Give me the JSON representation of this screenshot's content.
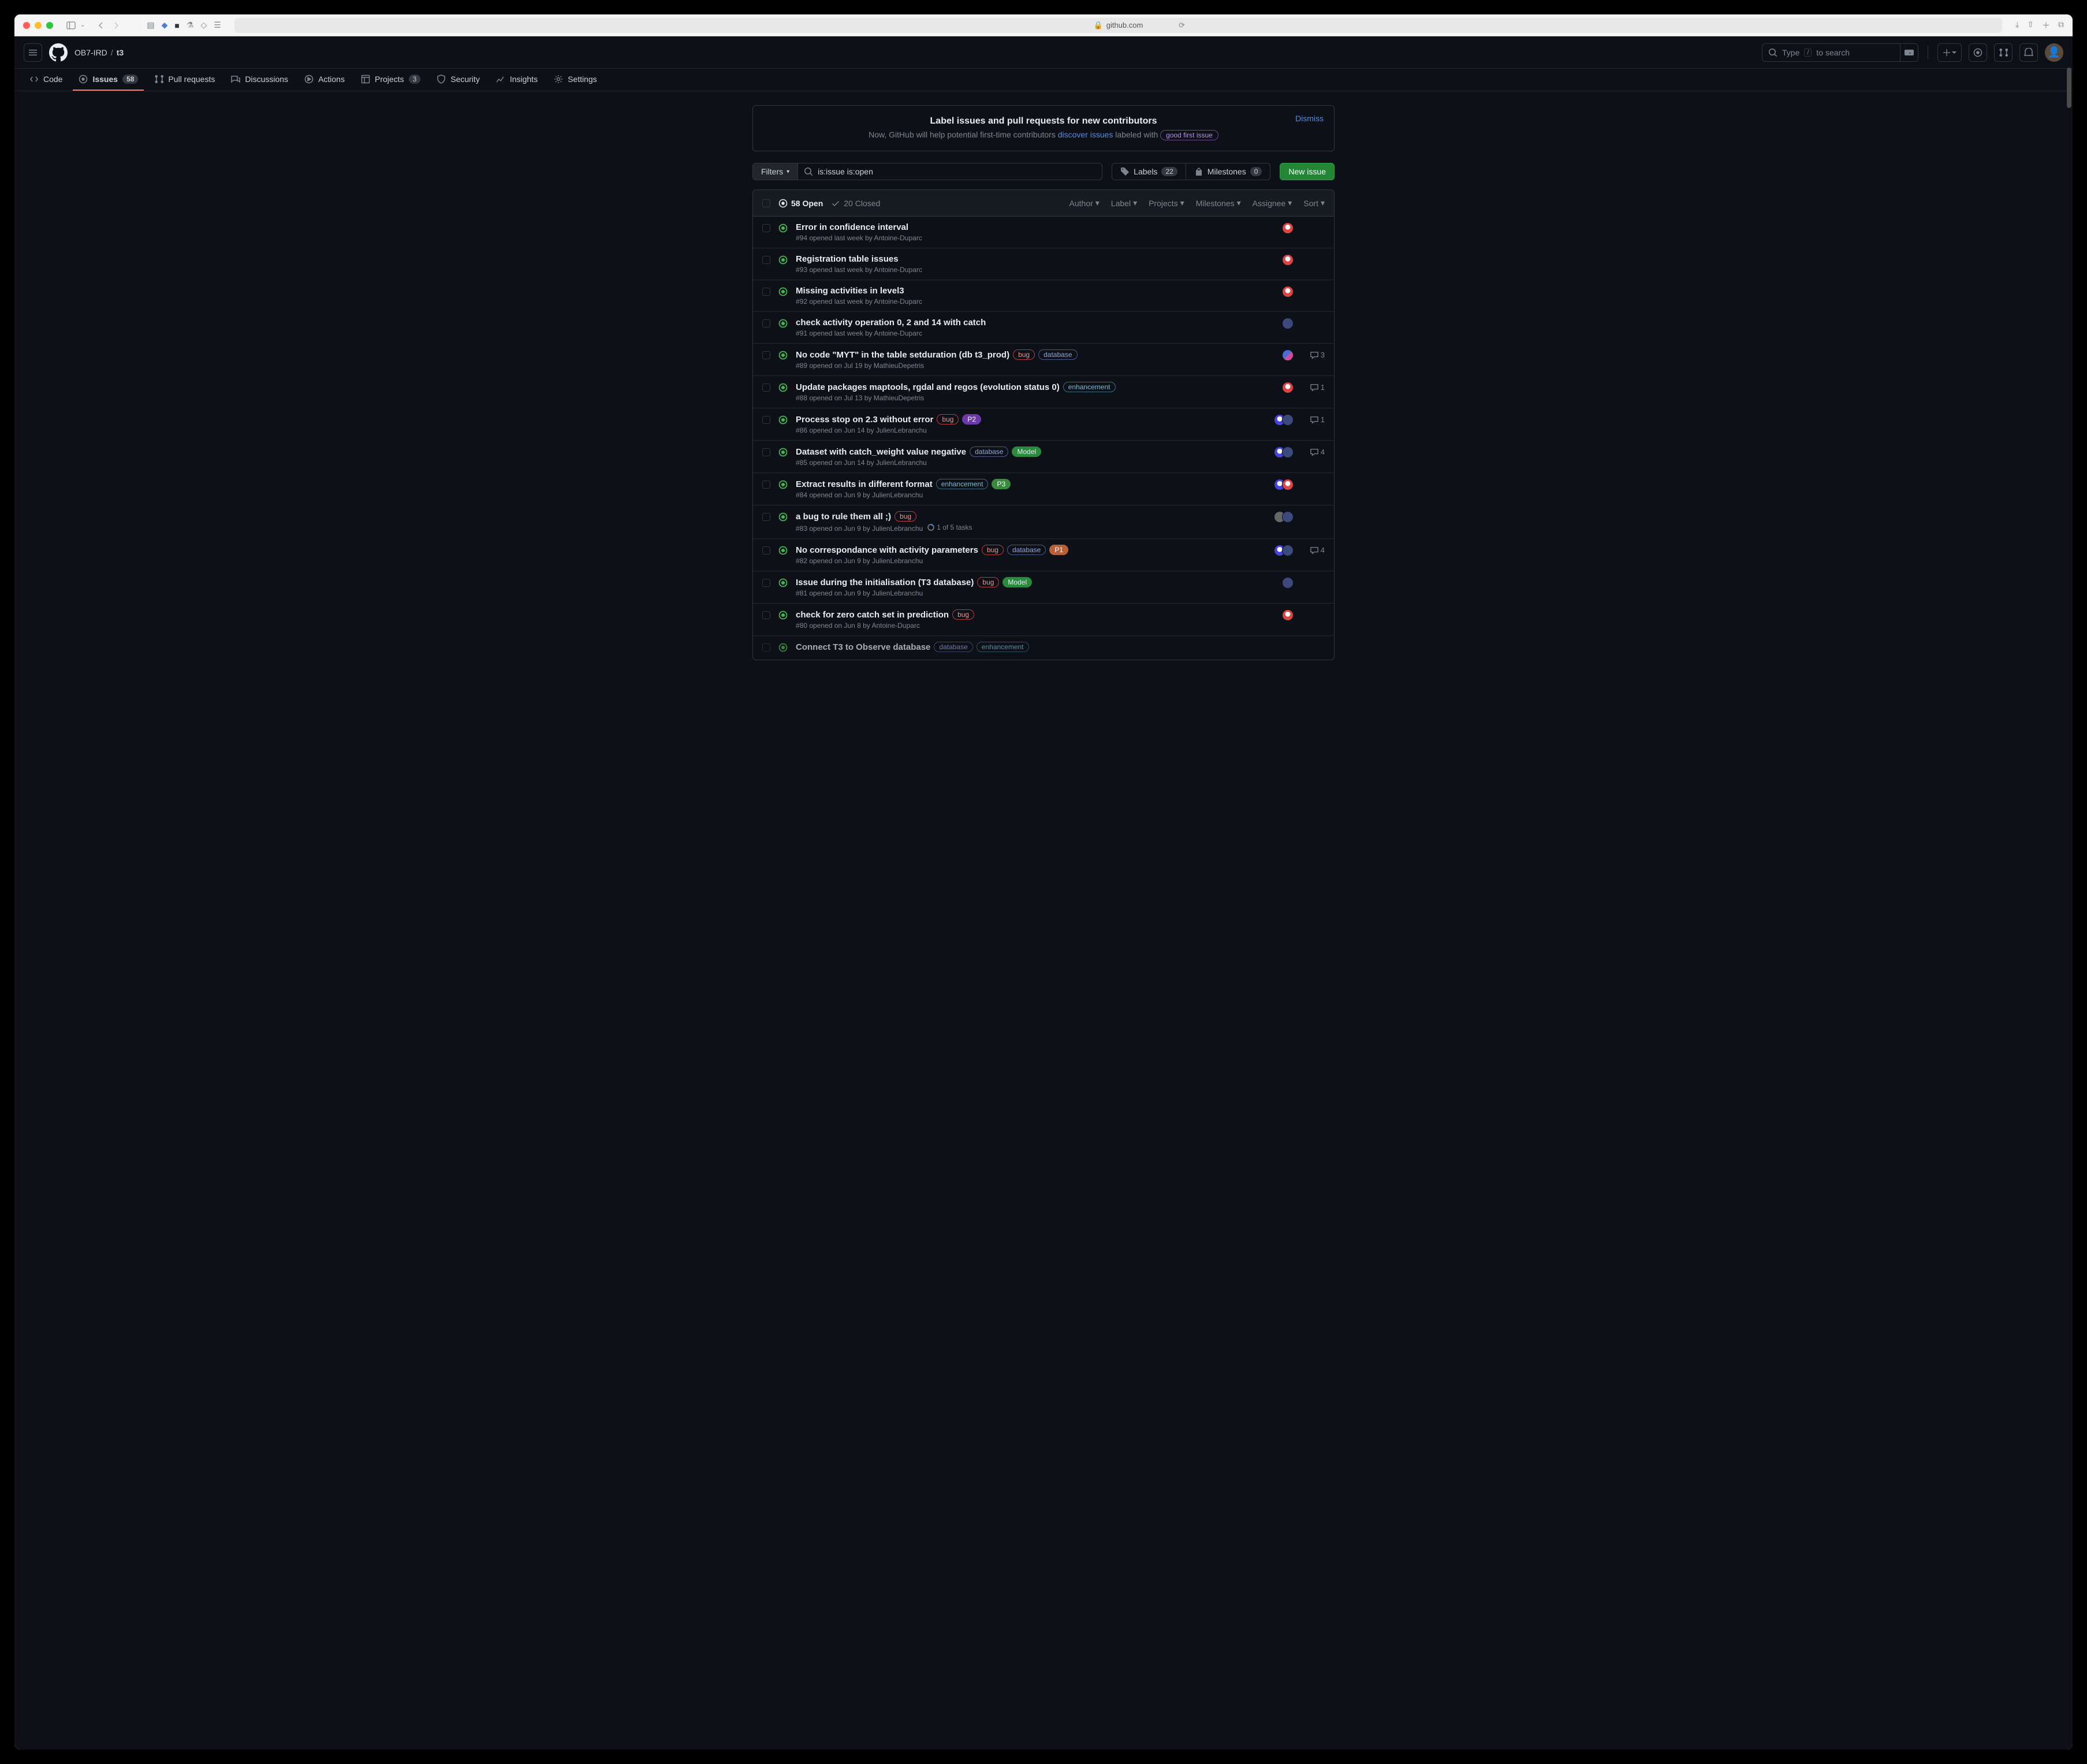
{
  "browser": {
    "url": "github.com",
    "lock": "🔒"
  },
  "breadcrumb": {
    "owner": "OB7-IRD",
    "repo": "t3"
  },
  "search": {
    "prefix": "Type",
    "kbd": "/",
    "suffix": "to search"
  },
  "tabs": {
    "code": "Code",
    "issues": "Issues",
    "issues_count": "58",
    "pulls": "Pull requests",
    "discussions": "Discussions",
    "actions": "Actions",
    "projects": "Projects",
    "projects_count": "3",
    "security": "Security",
    "insights": "Insights",
    "settings": "Settings"
  },
  "callout": {
    "title": "Label issues and pull requests for new contributors",
    "body_prefix": "Now, GitHub will help potential first-time contributors ",
    "link": "discover issues",
    "body_suffix": " labeled with ",
    "label": "good first issue",
    "dismiss": "Dismiss"
  },
  "filters": {
    "button": "Filters",
    "query": "is:issue is:open",
    "labels": "Labels",
    "labels_count": "22",
    "milestones": "Milestones",
    "milestones_count": "0",
    "new_issue": "New issue"
  },
  "list_header": {
    "open": "58 Open",
    "closed": "20 Closed",
    "f_author": "Author",
    "f_label": "Label",
    "f_projects": "Projects",
    "f_milestones": "Milestones",
    "f_assignee": "Assignee",
    "f_sort": "Sort"
  },
  "issues": [
    {
      "title": "Error in confidence interval",
      "meta": "#94 opened last week by Antoine-Duparc",
      "labels": [],
      "avatars": [
        "red"
      ],
      "comments": ""
    },
    {
      "title": "Registration table issues",
      "meta": "#93 opened last week by Antoine-Duparc",
      "labels": [],
      "avatars": [
        "red"
      ],
      "comments": ""
    },
    {
      "title": "Missing activities in level3",
      "meta": "#92 opened last week by Antoine-Duparc",
      "labels": [],
      "avatars": [
        "red"
      ],
      "comments": ""
    },
    {
      "title": "check activity operation 0, 2 and 14 with catch",
      "meta": "#91 opened last week by Antoine-Duparc",
      "labels": [],
      "avatars": [
        "navy"
      ],
      "comments": ""
    },
    {
      "title": "No code \"MYT\" in the table setduration (db t3_prod)",
      "meta": "#89 opened on Jul 19 by MathieuDepetris",
      "labels": [
        {
          "t": "bug",
          "c": "bug"
        },
        {
          "t": "database",
          "c": "database"
        }
      ],
      "avatars": [
        "stripe"
      ],
      "comments": "3"
    },
    {
      "title": "Update packages maptools, rgdal and regos (evolution status 0)",
      "meta": "#88 opened on Jul 13 by MathieuDepetris",
      "labels": [
        {
          "t": "enhancement",
          "c": "enhancement"
        }
      ],
      "avatars": [
        "red"
      ],
      "comments": "1"
    },
    {
      "title": "Process stop on 2.3 without error",
      "meta": "#86 opened on Jun 14 by JulienLebranchu",
      "labels": [
        {
          "t": "bug",
          "c": "bug"
        },
        {
          "t": "P2",
          "c": "p2"
        }
      ],
      "avatars": [
        "blue",
        "navy"
      ],
      "comments": "1"
    },
    {
      "title": "Dataset with catch_weight value negative",
      "meta": "#85 opened on Jun 14 by JulienLebranchu",
      "labels": [
        {
          "t": "database",
          "c": "database"
        },
        {
          "t": "Model",
          "c": "model"
        }
      ],
      "avatars": [
        "blue",
        "navy"
      ],
      "comments": "4"
    },
    {
      "title": "Extract results in different format",
      "meta": "#84 opened on Jun 9 by JulienLebranchu",
      "labels": [
        {
          "t": "enhancement",
          "c": "enhancement"
        },
        {
          "t": "P3",
          "c": "p3"
        }
      ],
      "avatars": [
        "blue",
        "red"
      ],
      "comments": ""
    },
    {
      "title": "a bug to rule them all ;)",
      "meta": "#83 opened on Jun 9 by JulienLebranchu",
      "tasks": "1 of 5 tasks",
      "labels": [
        {
          "t": "bug",
          "c": "bug"
        }
      ],
      "avatars": [
        "gray",
        "navy"
      ],
      "comments": ""
    },
    {
      "title": "No correspondance with activity parameters",
      "meta": "#82 opened on Jun 9 by JulienLebranchu",
      "labels": [
        {
          "t": "bug",
          "c": "bug"
        },
        {
          "t": "database",
          "c": "database"
        },
        {
          "t": "P1",
          "c": "p1"
        }
      ],
      "avatars": [
        "blue",
        "navy"
      ],
      "comments": "4"
    },
    {
      "title": "Issue during the initialisation (T3 database)",
      "meta": "#81 opened on Jun 9 by JulienLebranchu",
      "labels": [
        {
          "t": "bug",
          "c": "bug"
        },
        {
          "t": "Model",
          "c": "model"
        }
      ],
      "avatars": [
        "navy"
      ],
      "comments": ""
    },
    {
      "title": "check for zero catch set in prediction",
      "meta": "#80 opened on Jun 8 by Antoine-Duparc",
      "labels": [
        {
          "t": "bug",
          "c": "bug"
        }
      ],
      "avatars": [
        "red"
      ],
      "comments": ""
    },
    {
      "title": "Connect T3 to Observe database",
      "meta": "",
      "labels": [
        {
          "t": "database",
          "c": "database"
        },
        {
          "t": "enhancement",
          "c": "enhancement"
        }
      ],
      "avatars": [],
      "comments": "",
      "cut": true
    }
  ]
}
